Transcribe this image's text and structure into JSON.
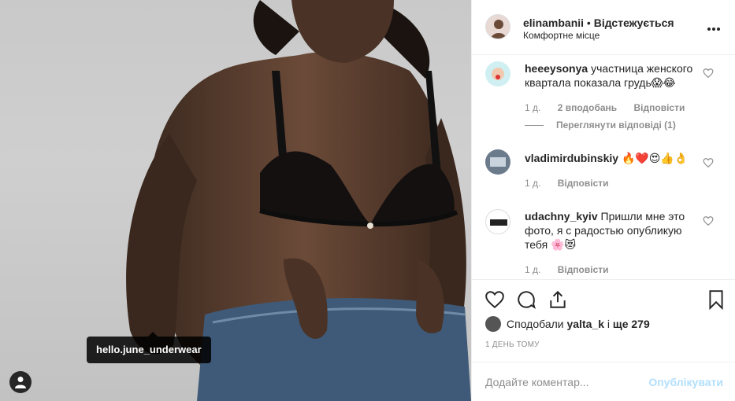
{
  "photo": {
    "tag_label": "hello.june_underwear"
  },
  "header": {
    "username": "elinambanii",
    "separator": "•",
    "follow_status": "Відстежується",
    "location": "Комфортне місце"
  },
  "comments": [
    {
      "username": "heeeysonya",
      "text": "участница женского квартала показала грудь😱😂",
      "time": "1 д.",
      "likes": "2 вподобань",
      "reply": "Відповісти",
      "view_replies": "Переглянути відповіді (1)"
    },
    {
      "username": "vladimirdubinskiy",
      "text": "🔥❤️😍👍👌",
      "time": "1 д.",
      "reply": "Відповісти"
    },
    {
      "username": "udachny_kyiv",
      "text": "Пришли мне это фото, я с радостью опубликую тебя 🌸😻",
      "time": "1 д.",
      "reply": "Відповісти"
    }
  ],
  "likes": {
    "prefix": "Сподобали",
    "user": "yalta_k",
    "mid": "і",
    "count_text": "ще 279"
  },
  "time_ago": "1 ДЕНЬ ТОМУ",
  "composer": {
    "placeholder": "Додайте коментар...",
    "post_label": "Опублікувати"
  },
  "icons": {
    "like": "heart-icon",
    "comment": "comment-icon",
    "share": "share-icon",
    "save": "bookmark-icon",
    "more": "more-icon",
    "user_tag": "user-icon"
  },
  "colors": {
    "link_disabled": "#b2dffc",
    "muted": "#8e8e8e",
    "text": "#262626"
  }
}
